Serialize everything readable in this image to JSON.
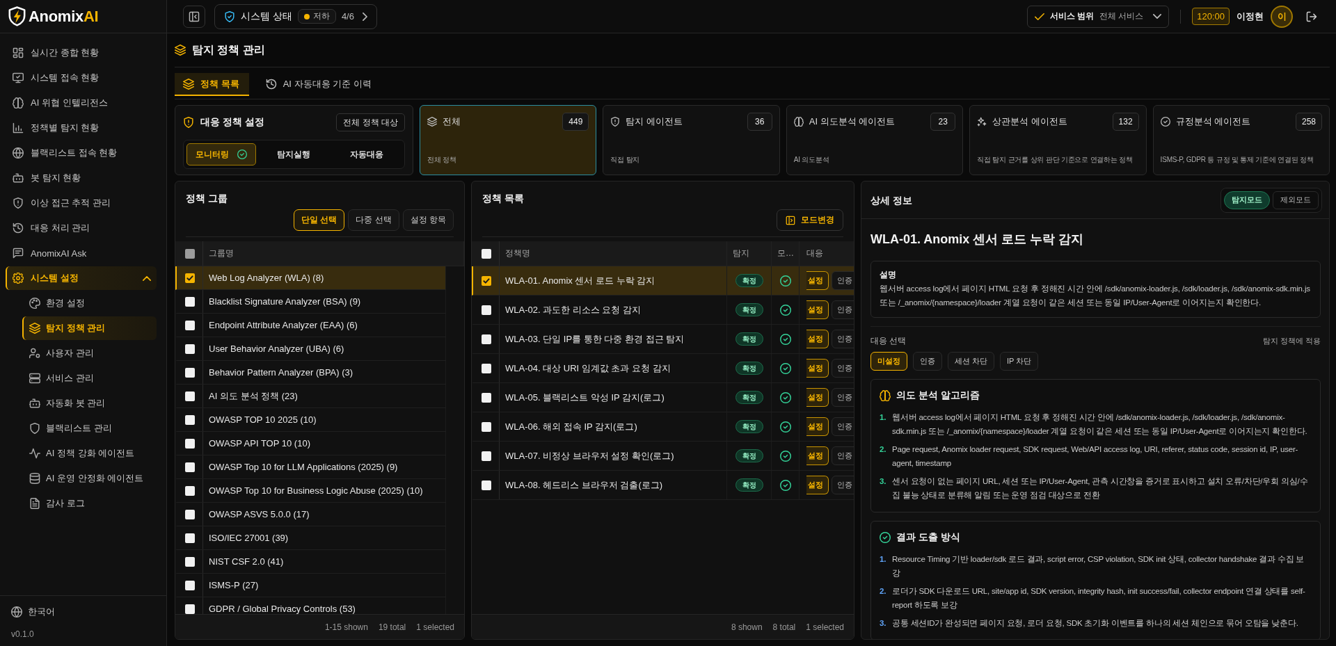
{
  "sidebar": {
    "logo": {
      "name": "Anomix",
      "accent": "AI"
    },
    "nav": [
      {
        "label": "실시간 종합 현황",
        "selected": false
      },
      {
        "label": "시스템 접속 현황",
        "selected": false
      },
      {
        "label": "AI 위협 인텔리전스",
        "selected": false
      },
      {
        "label": "정책별 탐지 현황",
        "selected": false
      },
      {
        "label": "블랙리스트 접속 현황",
        "selected": false
      },
      {
        "label": "봇 탐지 현황",
        "selected": false
      },
      {
        "label": "이상 접근 추적 관리",
        "selected": false
      },
      {
        "label": "대응 처리 관리",
        "selected": false
      },
      {
        "label": "AnomixAI Ask",
        "selected": false
      },
      {
        "label": "시스템 설정",
        "selected": true,
        "expanded": true,
        "children": [
          {
            "label": "환경 설정",
            "selected": false
          },
          {
            "label": "탐지 정책 관리",
            "selected": true
          },
          {
            "label": "사용자 관리",
            "selected": false
          },
          {
            "label": "서비스 관리",
            "selected": false
          },
          {
            "label": "자동화 봇 관리",
            "selected": false
          },
          {
            "label": "블랙리스트 관리",
            "selected": false
          },
          {
            "label": "AI 정책 강화 에이전트",
            "selected": false
          },
          {
            "label": "AI 운영 안정화 에이전트",
            "selected": false
          },
          {
            "label": "감사 로그",
            "selected": false
          }
        ]
      }
    ],
    "language": "한국어",
    "version": "v0.1.0"
  },
  "topbar": {
    "system_status": {
      "label": "시스템 상태",
      "state": "저하",
      "count": "4/6"
    },
    "service_scope": {
      "label": "서비스 범위",
      "value": "전체 서비스"
    },
    "session_timer": "120:00",
    "user": {
      "name": "이정현",
      "initial": "이"
    }
  },
  "page": {
    "title": "탐지 정책 관리",
    "tabs": [
      {
        "label": "정책 목록",
        "selected": true
      },
      {
        "label": "AI 자동대응 기준 이력",
        "selected": false
      }
    ]
  },
  "response_policy": {
    "title": "대응 정책 설정",
    "scope_button": "전체 정책 대상",
    "modes": [
      {
        "label": "모니터링",
        "selected": true
      },
      {
        "label": "탐지실행",
        "selected": false
      },
      {
        "label": "자동대응",
        "selected": false
      }
    ]
  },
  "stat_cards": [
    {
      "title": "전체",
      "count": "449",
      "description": "전체 정책",
      "selected": true
    },
    {
      "title": "탐지 에이전트",
      "count": "36",
      "description": "직접 탐지",
      "selected": false
    },
    {
      "title": "AI 의도분석 에이전트",
      "count": "23",
      "description": "AI 의도분석",
      "selected": false
    },
    {
      "title": "상관분석 에이전트",
      "count": "132",
      "description": "직접 탐지 근거를 상위 판단 기준으로 연결하는 정책",
      "selected": false
    },
    {
      "title": "규정분석 에이전트",
      "count": "258",
      "description": "ISMS-P, GDPR 등 규정 및 통제 기준에 연결된 정책",
      "selected": false
    }
  ],
  "groups": {
    "title": "정책 그룹",
    "select_modes": [
      {
        "label": "단일 선택",
        "selected": true
      },
      {
        "label": "다중 선택",
        "selected": false
      },
      {
        "label": "설정 항목",
        "selected": false
      }
    ],
    "select_all": {
      "checked": false,
      "disabled": true
    },
    "columns": [
      "그룹명"
    ],
    "rows": [
      {
        "name": "Web Log Analyzer (WLA) (8)",
        "selected": true,
        "checked": true
      },
      {
        "name": "Blacklist Signature Analyzer (BSA) (9)",
        "selected": false,
        "checked": false
      },
      {
        "name": "Endpoint Attribute Analyzer (EAA) (6)",
        "selected": false,
        "checked": false
      },
      {
        "name": "User Behavior Analyzer (UBA) (6)",
        "selected": false,
        "checked": false
      },
      {
        "name": "Behavior Pattern Analyzer (BPA) (3)",
        "selected": false,
        "checked": false
      },
      {
        "name": "AI 의도 분석 정책 (23)",
        "selected": false,
        "checked": false
      },
      {
        "name": "OWASP TOP 10 2025 (10)",
        "selected": false,
        "checked": false
      },
      {
        "name": "OWASP API TOP 10 (10)",
        "selected": false,
        "checked": false
      },
      {
        "name": "OWASP Top 10 for LLM Applications (2025) (9)",
        "selected": false,
        "checked": false
      },
      {
        "name": "OWASP Top 10 for Business Logic Abuse (2025) (10)",
        "selected": false,
        "checked": false
      },
      {
        "name": "OWASP ASVS 5.0.0 (17)",
        "selected": false,
        "checked": false
      },
      {
        "name": "ISO/IEC 27001 (39)",
        "selected": false,
        "checked": false
      },
      {
        "name": "NIST CSF 2.0 (41)",
        "selected": false,
        "checked": false
      },
      {
        "name": "ISMS-P (27)",
        "selected": false,
        "checked": false
      },
      {
        "name": "GDPR / Global Privacy Controls (53)",
        "selected": false,
        "checked": false
      }
    ],
    "footer": {
      "shown": "1-15 shown",
      "total": "19 total",
      "selected": "1 selected"
    }
  },
  "policies": {
    "title": "정책 목록",
    "mode_button": "모드변경",
    "select_all": {
      "checked": false,
      "disabled": false
    },
    "columns": [
      "정책명",
      "탐지",
      "모…",
      "대응"
    ],
    "rows": [
      {
        "name": "WLA-01. Anomix 센서 로드 누락 감지",
        "selected": true,
        "checked": true,
        "detection": "확정",
        "monitored": true,
        "actions": [
          {
            "label": "설정",
            "selected": true
          },
          {
            "label": "인증",
            "selected": false
          }
        ]
      },
      {
        "name": "WLA-02. 과도한 리소스 요청 감지",
        "selected": false,
        "checked": false,
        "detection": "확정",
        "monitored": true,
        "actions": [
          {
            "label": "설정",
            "selected": true
          },
          {
            "label": "인증",
            "selected": false
          }
        ]
      },
      {
        "name": "WLA-03. 단일 IP를 통한 다중 환경 접근 탐지",
        "selected": false,
        "checked": false,
        "detection": "확정",
        "monitored": true,
        "actions": [
          {
            "label": "설정",
            "selected": true
          },
          {
            "label": "인증",
            "selected": false
          }
        ]
      },
      {
        "name": "WLA-04. 대상 URI 임계값 초과 요청 감지",
        "selected": false,
        "checked": false,
        "detection": "확정",
        "monitored": true,
        "actions": [
          {
            "label": "설정",
            "selected": true
          },
          {
            "label": "인증",
            "selected": false
          }
        ]
      },
      {
        "name": "WLA-05. 블랙리스트 악성 IP 감지(로그)",
        "selected": false,
        "checked": false,
        "detection": "확정",
        "monitored": true,
        "actions": [
          {
            "label": "설정",
            "selected": true
          },
          {
            "label": "인증",
            "selected": false
          }
        ]
      },
      {
        "name": "WLA-06. 해외 접속 IP 감지(로그)",
        "selected": false,
        "checked": false,
        "detection": "확정",
        "monitored": true,
        "actions": [
          {
            "label": "설정",
            "selected": true
          },
          {
            "label": "인증",
            "selected": false
          }
        ]
      },
      {
        "name": "WLA-07. 비정상 브라우저 설정 확인(로그)",
        "selected": false,
        "checked": false,
        "detection": "확정",
        "monitored": true,
        "actions": [
          {
            "label": "설정",
            "selected": true
          },
          {
            "label": "인증",
            "selected": false
          }
        ]
      },
      {
        "name": "WLA-08. 헤드리스 브라우저 검출(로그)",
        "selected": false,
        "checked": false,
        "detection": "확정",
        "monitored": true,
        "actions": [
          {
            "label": "설정",
            "selected": true
          },
          {
            "label": "인증",
            "selected": false
          }
        ]
      }
    ],
    "footer": {
      "shown": "8 shown",
      "total": "8 total",
      "selected": "1 selected"
    }
  },
  "detail": {
    "title": "상세 정보",
    "modes": [
      {
        "label": "탐지모드",
        "selected": true
      },
      {
        "label": "제외모드",
        "selected": false
      }
    ],
    "policy_title": "WLA-01. Anomix 센서 로드 누락 감지",
    "description": {
      "label": "설명",
      "text": "웹서버 access log에서 페이지 HTML 요청 후 정해진 시간 안에 /sdk/anomix-loader.js, /sdk/loader.js, /sdk/anomix-sdk.min.js 또는 /_anomix/{namespace}/loader 계열 요청이 같은 세션 또는 동일 IP/User-Agent로 이어지는지 확인한다."
    },
    "response": {
      "label": "대응 선택",
      "hint": "탐지 정책에 적용",
      "options": [
        {
          "label": "미설정",
          "selected": true
        },
        {
          "label": "인증",
          "selected": false
        },
        {
          "label": "세션 차단",
          "selected": false
        },
        {
          "label": "IP 차단",
          "selected": false
        }
      ]
    },
    "sections": [
      {
        "kind": "algorithm",
        "title": "의도 분석 알고리즘",
        "items": [
          {
            "number": "1.",
            "text": "웹서버 access log에서 페이지 HTML 요청 후 정해진 시간 안에 /sdk/anomix-loader.js, /sdk/loader.js, /sdk/anomix-sdk.min.js 또는 /_anomix/{namespace}/loader 계열 요청이 같은 세션 또는 동일 IP/User-Agent로 이어지는지 확인한다."
          },
          {
            "number": "2.",
            "text": "Page request, Anomix loader request, SDK request, Web/API access log, URI, referer, status code, session id, IP, user-agent, timestamp"
          },
          {
            "number": "3.",
            "text": "센서 요청이 없는 페이지 URL, 세션 또는 IP/User-Agent, 관측 시간창을 증거로 표시하고 설치 오류/차단/우회 의심/수집 불능 상태로 분류해 알림 또는 운영 점검 대상으로 전환"
          }
        ]
      },
      {
        "kind": "result",
        "title": "결과 도출 방식",
        "items": [
          {
            "number": "1.",
            "text": "Resource Timing 기반 loader/sdk 로드 결과, script error, CSP violation, SDK init 상태, collector handshake 결과 수집 보강"
          },
          {
            "number": "2.",
            "text": "로더가 SDK 다운로드 URL, site/app id, SDK version, integrity hash, init success/fail, collector endpoint 연결 상태를 self-report 하도록 보강"
          },
          {
            "number": "3.",
            "text": "공통 세션ID가 완성되면 페이지 요청, 로더 요청, SDK 초기화 이벤트를 하나의 세션 체인으로 묶어 오탐을 낮춘다."
          }
        ]
      }
    ]
  }
}
